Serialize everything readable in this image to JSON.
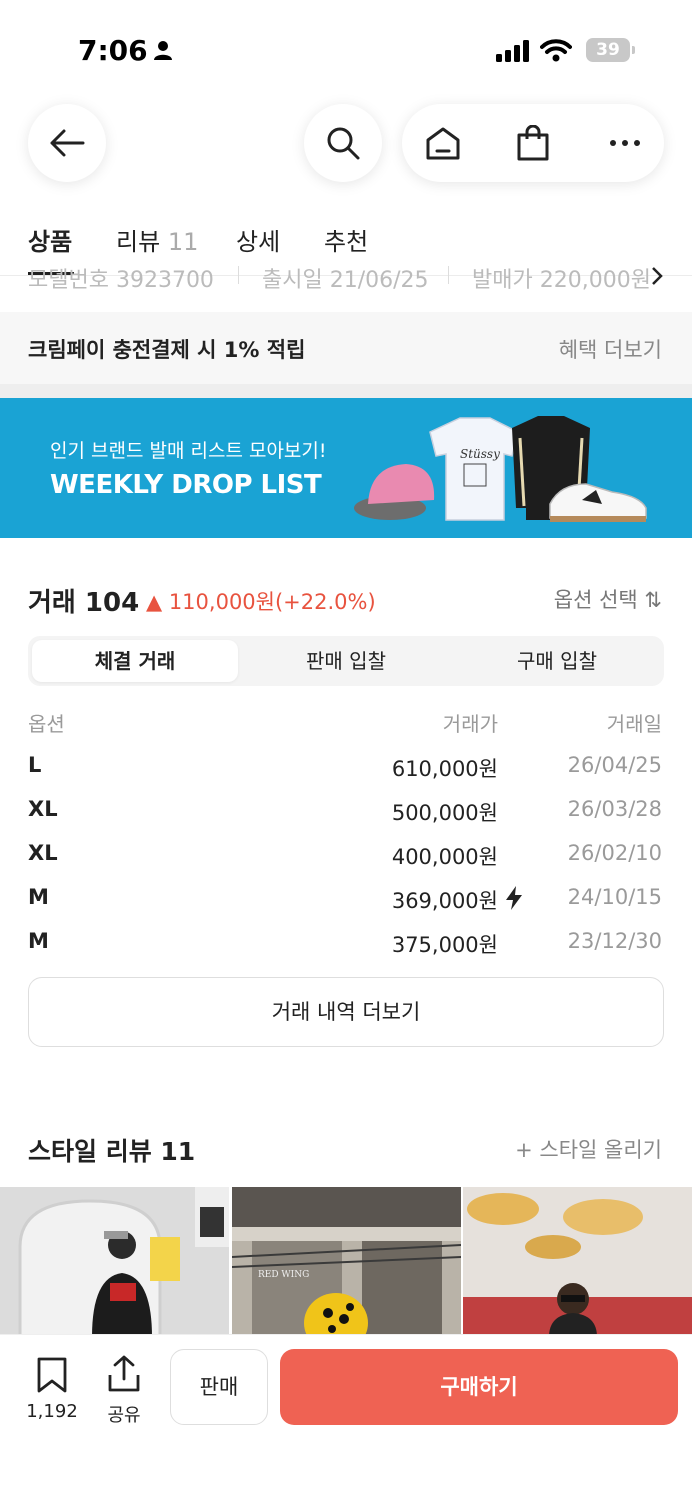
{
  "status_bar": {
    "time": "7:06",
    "battery": "39"
  },
  "tabs": [
    {
      "label": "상품",
      "count": ""
    },
    {
      "label": "리뷰",
      "count": "11"
    },
    {
      "label": "상세",
      "count": ""
    },
    {
      "label": "추천",
      "count": ""
    }
  ],
  "product_info_cutoff": [
    "모델번호 3923700",
    "출시일 21/06/25",
    "발매가 220,000원"
  ],
  "benefit": {
    "text": "크림페이 충전결제 시 1% 적립",
    "link": "혜택 더보기"
  },
  "banner": {
    "subtitle": "인기 브랜드 발매 리스트 모아보기!",
    "title": "WEEKLY DROP LIST",
    "color": "#1aa3d4"
  },
  "trade": {
    "title": "거래 104",
    "change": "▲ 110,000원(+22.0%)",
    "option_select": "옵션 선택 ⇅",
    "segments": [
      "체결 거래",
      "판매 입찰",
      "구매 입찰"
    ],
    "active_segment": 0,
    "columns": [
      "옵션",
      "거래가",
      "거래일"
    ],
    "rows": [
      {
        "option": "L",
        "price": "610,000원",
        "date": "26/04/25",
        "quick": false
      },
      {
        "option": "XL",
        "price": "500,000원",
        "date": "26/03/28",
        "quick": false
      },
      {
        "option": "XL",
        "price": "400,000원",
        "date": "26/02/10",
        "quick": false
      },
      {
        "option": "M",
        "price": "369,000원",
        "date": "24/10/15",
        "quick": true
      },
      {
        "option": "M",
        "price": "375,000원",
        "date": "23/12/30",
        "quick": false
      }
    ],
    "more_button": "거래 내역 더보기"
  },
  "style_review": {
    "title": "스타일 리뷰 11",
    "upload": "+ 스타일 올리기",
    "photo_sign": "RED WING"
  },
  "bottom_bar": {
    "bookmark_count": "1,192",
    "share_label": "공유",
    "sell_label": "판매",
    "buy_label": "구매하기",
    "accent": "#ef6253"
  },
  "colors": {
    "price_up": "#e8533f"
  }
}
